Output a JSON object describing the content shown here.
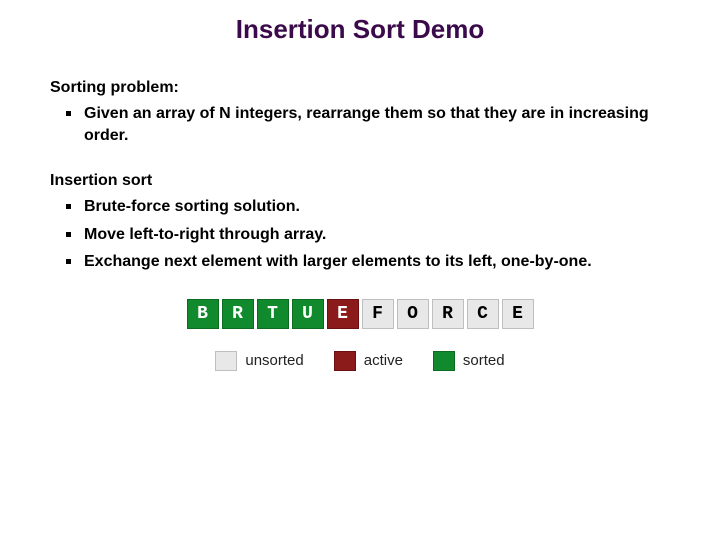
{
  "title": "Insertion Sort Demo",
  "section1": {
    "heading": "Sorting problem:",
    "items": [
      "Given an array of N integers, rearrange them so that they are in increasing order."
    ]
  },
  "section2": {
    "heading": "Insertion sort",
    "items": [
      "Brute-force sorting solution.",
      "Move left-to-right through array.",
      "Exchange next element with larger elements to its left, one-by-one."
    ]
  },
  "cells": [
    {
      "letter": "B",
      "state": "sorted"
    },
    {
      "letter": "R",
      "state": "sorted"
    },
    {
      "letter": "T",
      "state": "sorted"
    },
    {
      "letter": "U",
      "state": "sorted"
    },
    {
      "letter": "E",
      "state": "active"
    },
    {
      "letter": "F",
      "state": "unsorted"
    },
    {
      "letter": "O",
      "state": "unsorted"
    },
    {
      "letter": "R",
      "state": "unsorted"
    },
    {
      "letter": "C",
      "state": "unsorted"
    },
    {
      "letter": "E",
      "state": "unsorted"
    }
  ],
  "legend": {
    "unsorted": "unsorted",
    "active": "active",
    "sorted": "sorted"
  }
}
